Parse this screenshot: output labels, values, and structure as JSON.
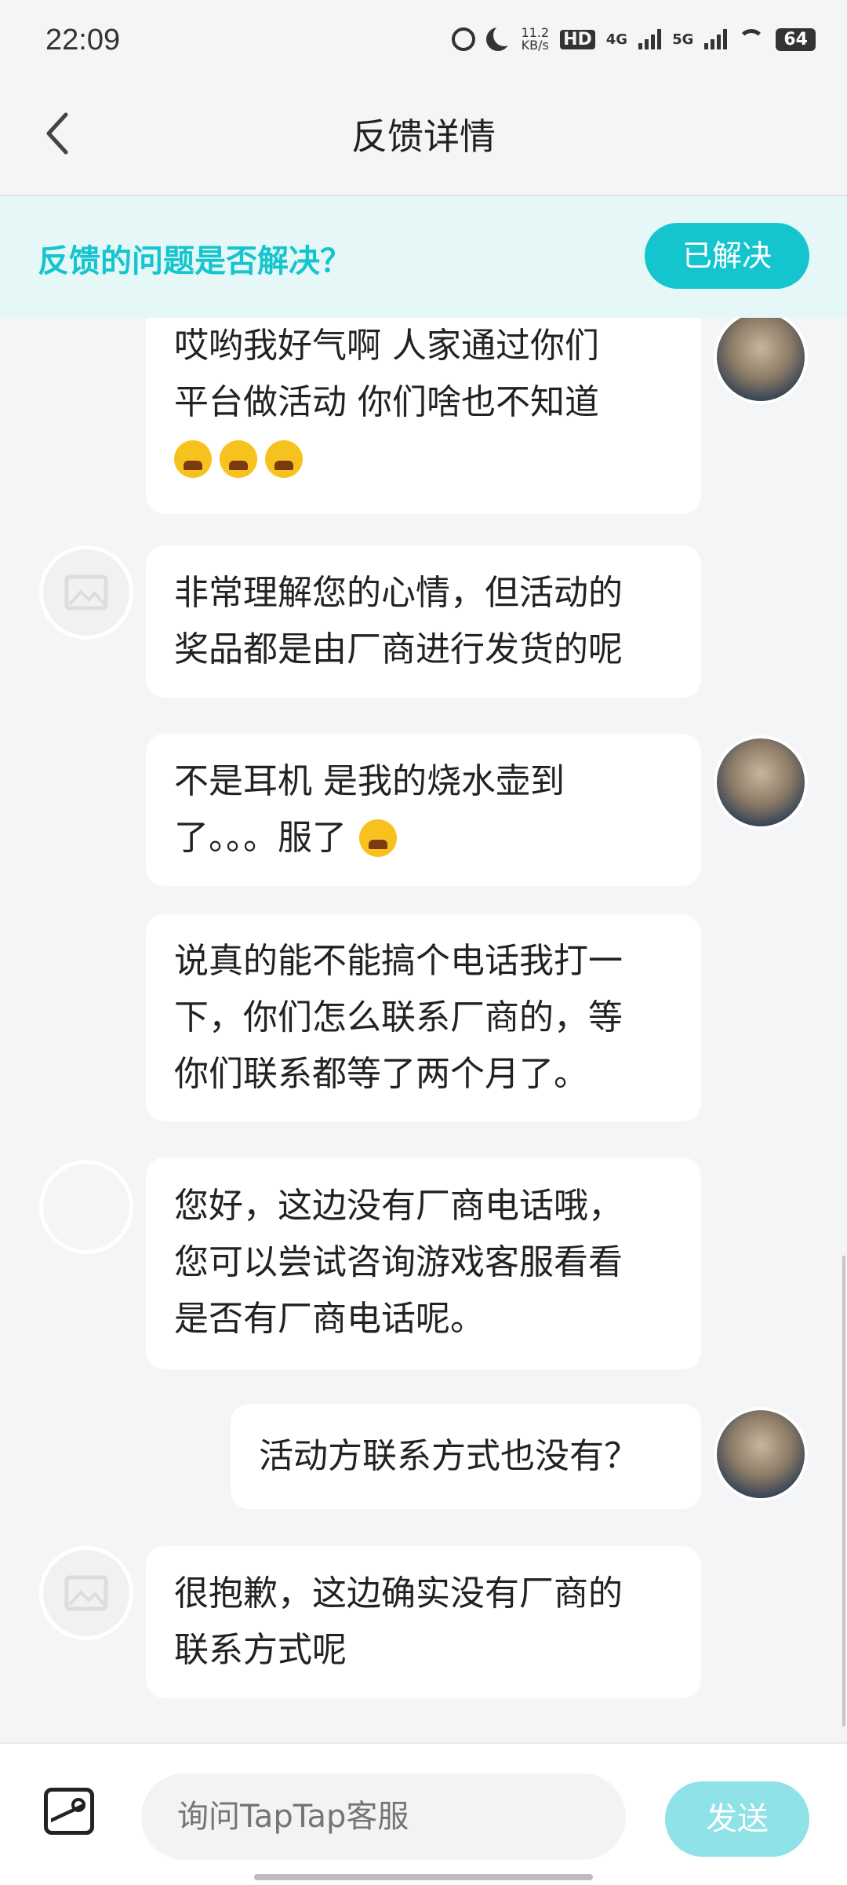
{
  "status": {
    "time": "22:09",
    "speed_top": "11.2",
    "speed_bottom": "KB/s",
    "hd": "HD",
    "sig1": "4G",
    "sig2": "5G",
    "battery": "64"
  },
  "header": {
    "title": "反馈详情"
  },
  "banner": {
    "question": "反馈的问题是否解决？",
    "button": "已解决"
  },
  "messages": [
    {
      "from": "user",
      "lines": [
        "哎哟我好气啊 人家通过你们",
        "平台做活动 你们啥也不知道"
      ],
      "emoji_count": 3
    },
    {
      "from": "staff",
      "lines": [
        "非常理解您的心情，但活动的",
        "奖品都是由厂商进行发货的呢"
      ]
    },
    {
      "from": "user",
      "lines": [
        "不是耳机 是我的烧水壶到",
        "了。。。服了"
      ],
      "emoji_count": 1
    },
    {
      "from": "user",
      "lines": [
        "说真的能不能搞个电话我打一",
        "下，你们怎么联系厂商的，等",
        "你们联系都等了两个月了。"
      ]
    },
    {
      "from": "staff",
      "lines": [
        "您好，这边没有厂商电话哦，",
        "您可以尝试咨询游戏客服看看",
        "是否有厂商电话呢。"
      ]
    },
    {
      "from": "user",
      "lines": [
        "活动方联系方式也没有？"
      ]
    },
    {
      "from": "staff",
      "lines": [
        "很抱歉，这边确实没有厂商的",
        "联系方式呢"
      ]
    }
  ],
  "input": {
    "placeholder": "询问TapTap客服",
    "send": "发送"
  },
  "colors": {
    "accent": "#15c5ce",
    "send_disabled": "#8fe2e7"
  }
}
